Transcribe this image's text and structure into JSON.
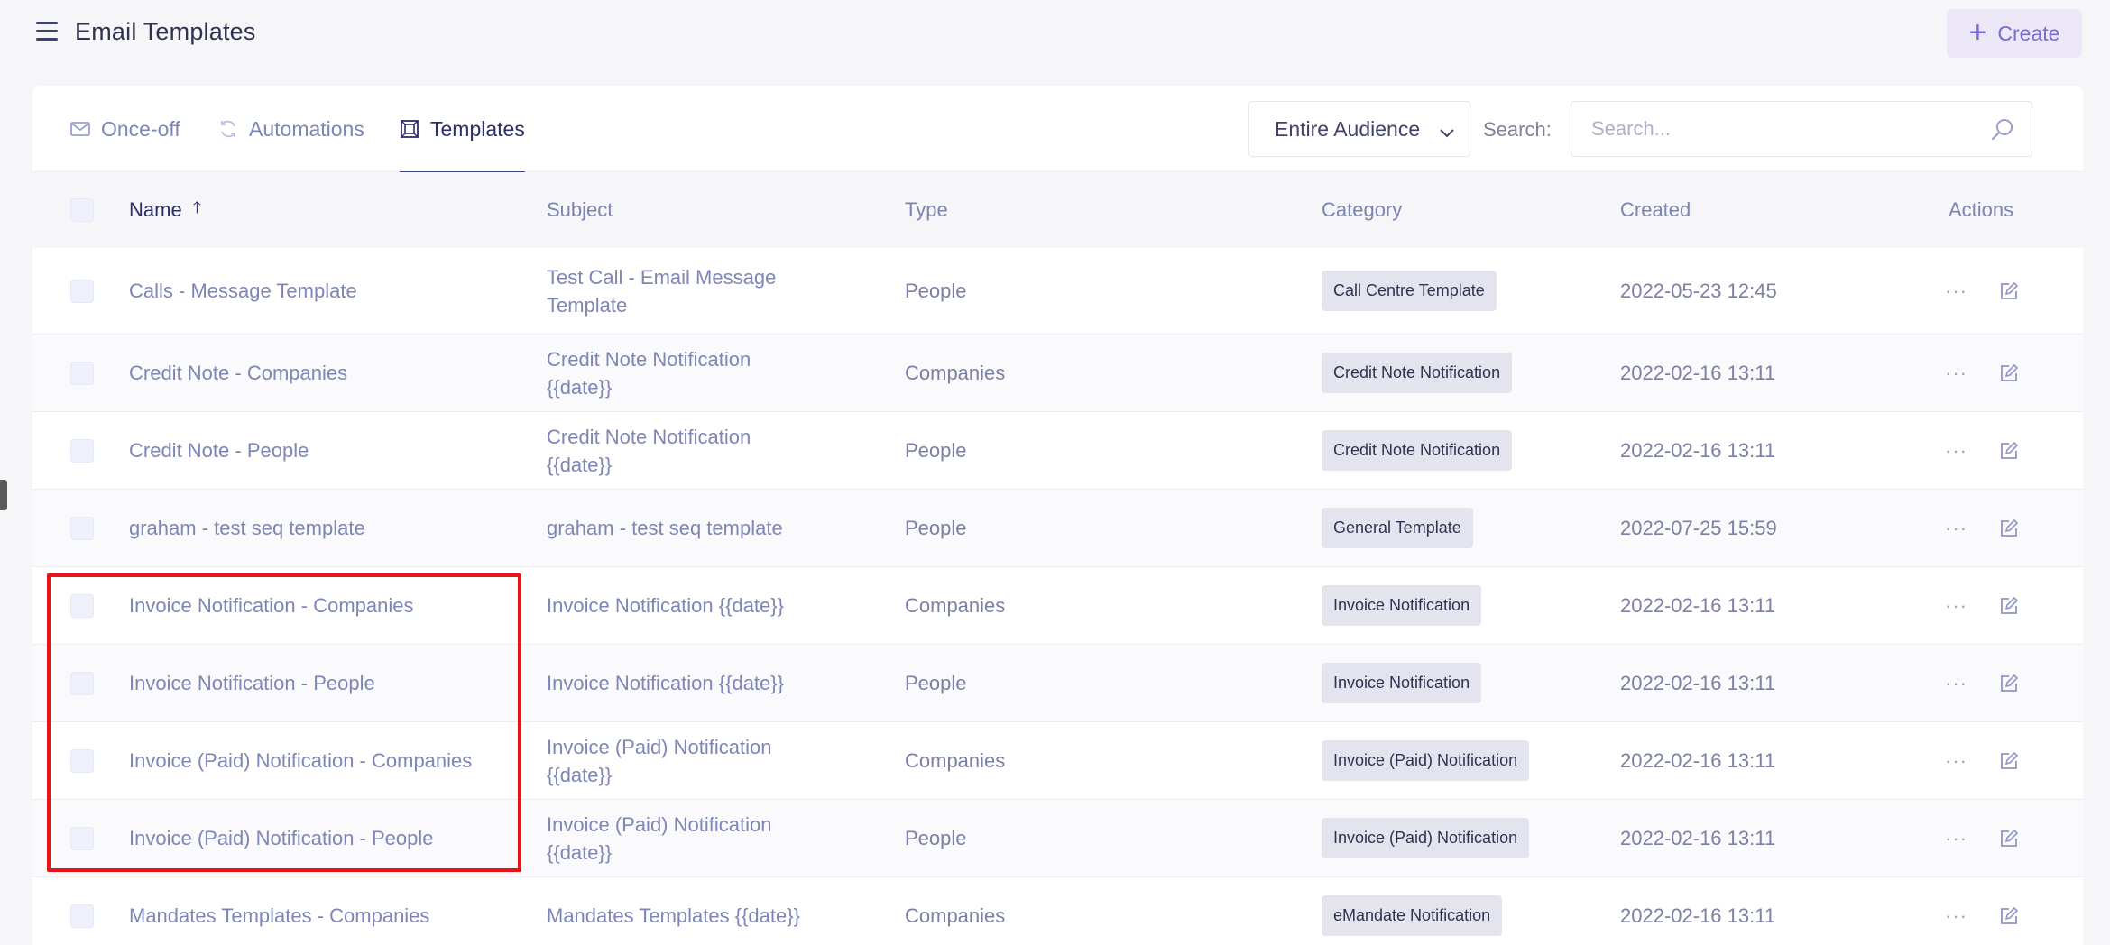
{
  "header": {
    "title": "Email Templates",
    "create_label": "Create"
  },
  "tabs": [
    {
      "label": "Once-off",
      "icon": "envelope-icon",
      "active": false
    },
    {
      "label": "Automations",
      "icon": "refresh-icon",
      "active": false
    },
    {
      "label": "Templates",
      "icon": "template-icon",
      "active": true
    }
  ],
  "filters": {
    "audience_selected": "Entire Audience",
    "search_label": "Search:",
    "search_placeholder": "Search..."
  },
  "table": {
    "columns": [
      "Name",
      "Subject",
      "Type",
      "Category",
      "Created",
      "Actions"
    ],
    "sorted_column": "Name",
    "sort_direction": "ascending",
    "rows": [
      {
        "name": "Calls - Message Template",
        "subject": "Test Call - Email Message Template",
        "type": "People",
        "category": "Call Centre Template",
        "created": "2022-05-23 12:45"
      },
      {
        "name": "Credit Note - Companies",
        "subject": "Credit Note Notification {{date}}",
        "type": "Companies",
        "category": "Credit Note Notification",
        "created": "2022-02-16 13:11"
      },
      {
        "name": "Credit Note - People",
        "subject": "Credit Note Notification {{date}}",
        "type": "People",
        "category": "Credit Note Notification",
        "created": "2022-02-16 13:11"
      },
      {
        "name": "graham - test seq template",
        "subject": "graham - test seq template",
        "type": "People",
        "category": "General Template",
        "created": "2022-07-25 15:59"
      },
      {
        "name": "Invoice Notification - Companies",
        "subject": "Invoice Notification {{date}}",
        "type": "Companies",
        "category": "Invoice Notification",
        "created": "2022-02-16 13:11"
      },
      {
        "name": "Invoice Notification - People",
        "subject": "Invoice Notification {{date}}",
        "type": "People",
        "category": "Invoice Notification",
        "created": "2022-02-16 13:11"
      },
      {
        "name": "Invoice (Paid) Notification - Companies",
        "subject": "Invoice (Paid) Notification {{date}}",
        "type": "Companies",
        "category": "Invoice (Paid) Notification",
        "created": "2022-02-16 13:11"
      },
      {
        "name": "Invoice (Paid) Notification - People",
        "subject": "Invoice (Paid) Notification {{date}}",
        "type": "People",
        "category": "Invoice (Paid) Notification",
        "created": "2022-02-16 13:11"
      },
      {
        "name": "Mandates Templates - Companies",
        "subject": "Mandates Templates {{date}}",
        "type": "Companies",
        "category": "eMandate Notification",
        "created": "2022-02-16 13:11"
      }
    ]
  },
  "actions": {
    "more_icon": "ellipsis-icon",
    "edit_icon": "edit-icon",
    "more_glyph": "···"
  },
  "annotation": {
    "highlight_color": "#e8141b"
  },
  "colors": {
    "accent": "#7b6bd6",
    "active_tab": "#2c2f6b",
    "badge_bg": "#e4e4ef"
  }
}
